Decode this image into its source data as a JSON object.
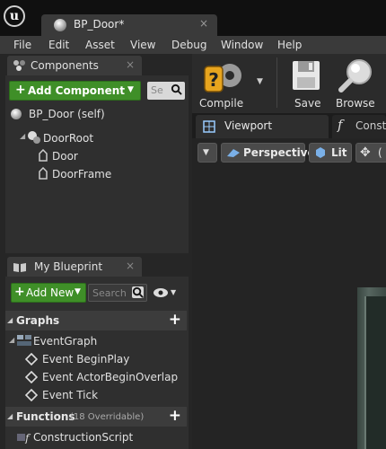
{
  "window": {
    "doc_tab": "BP_Door*",
    "close_glyph": "×"
  },
  "menu": {
    "items": [
      "File",
      "Edit",
      "Asset",
      "View",
      "Debug",
      "Window",
      "Help"
    ]
  },
  "components_panel": {
    "tab_label": "Components",
    "add_button": "Add Component",
    "search_placeholder": "Se",
    "self_item": "BP_Door (self)",
    "root": "DoorRoot",
    "children": [
      "Door",
      "DoorFrame"
    ]
  },
  "blueprint_panel": {
    "tab_label": "My Blueprint",
    "add_button": "Add New",
    "search_placeholder": "Search",
    "graphs_label": "Graphs",
    "event_graph": "EventGraph",
    "events": [
      "Event BeginPlay",
      "Event ActorBeginOverlap",
      "Event Tick"
    ],
    "functions_label": "Functions",
    "functions_sub": "(18 Overridable)",
    "functions": [
      "ConstructionScript"
    ]
  },
  "toolbar": {
    "compile": "Compile",
    "save": "Save",
    "browse": "Browse"
  },
  "viewport_tabs": {
    "viewport": "Viewport",
    "construction": "Const"
  },
  "viewport": {
    "perspective": "Perspective",
    "lit": "Lit",
    "extra": "("
  },
  "icons": [
    "unreal-logo-icon",
    "blueprint-icon",
    "components-icon",
    "plus-icon",
    "search-icon",
    "component-sphere-icon",
    "scene-root-icon",
    "mesh-icon",
    "book-icon",
    "eye-icon",
    "graph-icon",
    "event-icon",
    "function-icon",
    "compile-icon",
    "save-icon",
    "browse-icon",
    "viewport-icon",
    "perspective-icon",
    "lit-icon",
    "transform-icon"
  ],
  "colors": {
    "accent_green": "#3f8f28",
    "panel": "#262626",
    "tab": "#3b3b3b"
  }
}
